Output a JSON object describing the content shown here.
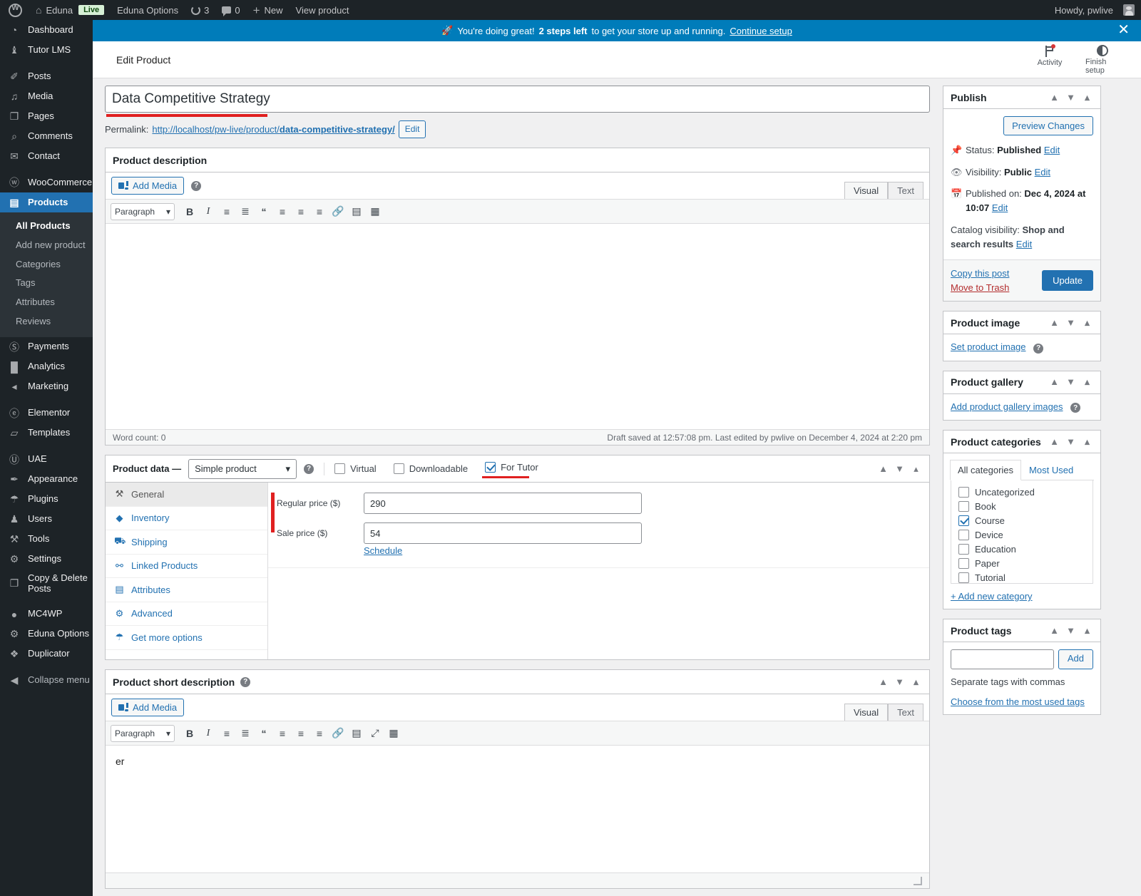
{
  "adminbar": {
    "site_name": "Eduna",
    "live_badge": "Live",
    "options_label": "Eduna Options",
    "updates_count": "3",
    "comments_count": "0",
    "new_label": "New",
    "view_product_label": "View product",
    "howdy": "Howdy, pwlive"
  },
  "notice": {
    "prefix": "You're doing great!",
    "bold": "2 steps left",
    "suffix": "to get your store up and running.",
    "link": "Continue setup",
    "close": "✕"
  },
  "wc_header": {
    "title": "Edit Product",
    "activity_label": "Activity",
    "finish_label": "Finish setup"
  },
  "sidebar": {
    "items": [
      {
        "label": "Dashboard",
        "icon": "dashboard-icon",
        "glyph": "◔"
      },
      {
        "label": "Tutor LMS",
        "icon": "tutor-lms-icon",
        "glyph": "♝"
      },
      {
        "sep": true
      },
      {
        "label": "Posts",
        "icon": "posts-icon",
        "glyph": "✐"
      },
      {
        "label": "Media",
        "icon": "media-icon",
        "glyph": "♫"
      },
      {
        "label": "Pages",
        "icon": "pages-icon",
        "glyph": "❐"
      },
      {
        "label": "Comments",
        "icon": "comments-icon",
        "glyph": "⌕"
      },
      {
        "label": "Contact",
        "icon": "contact-icon",
        "glyph": "✉"
      },
      {
        "sep": true
      },
      {
        "label": "WooCommerce",
        "icon": "woocommerce-icon",
        "glyph": "ⓦ"
      },
      {
        "label": "Products",
        "icon": "products-icon",
        "glyph": "▤",
        "current": true
      }
    ],
    "submenu": [
      {
        "label": "All Products",
        "active": true
      },
      {
        "label": "Add new product"
      },
      {
        "label": "Categories"
      },
      {
        "label": "Tags"
      },
      {
        "label": "Attributes"
      },
      {
        "label": "Reviews"
      }
    ],
    "items2": [
      {
        "label": "Payments",
        "icon": "payments-icon",
        "glyph": "Ⓢ"
      },
      {
        "label": "Analytics",
        "icon": "analytics-icon",
        "glyph": "█"
      },
      {
        "label": "Marketing",
        "icon": "marketing-icon",
        "glyph": "◂"
      },
      {
        "sep": true
      },
      {
        "label": "Elementor",
        "icon": "elementor-icon",
        "glyph": "ⓔ"
      },
      {
        "label": "Templates",
        "icon": "templates-icon",
        "glyph": "▱"
      },
      {
        "sep": true
      },
      {
        "label": "UAE",
        "icon": "uae-icon",
        "glyph": "Ⓤ"
      },
      {
        "label": "Appearance",
        "icon": "appearance-icon",
        "glyph": "✒"
      },
      {
        "label": "Plugins",
        "icon": "plugins-icon",
        "glyph": "☂"
      },
      {
        "label": "Users",
        "icon": "users-icon",
        "glyph": "♟"
      },
      {
        "label": "Tools",
        "icon": "tools-icon",
        "glyph": "⚒"
      },
      {
        "label": "Settings",
        "icon": "settings-icon",
        "glyph": "⚙"
      },
      {
        "label": "Copy & Delete Posts",
        "icon": "copy-delete-posts-icon",
        "glyph": "❐",
        "multiline": true
      },
      {
        "sep": true
      },
      {
        "label": "MC4WP",
        "icon": "mc4wp-icon",
        "glyph": "●"
      },
      {
        "label": "Eduna Options",
        "icon": "eduna-options-icon",
        "glyph": "⚙"
      },
      {
        "label": "Duplicator",
        "icon": "duplicator-icon",
        "glyph": "❖"
      },
      {
        "sep": true
      },
      {
        "label": "Collapse menu",
        "icon": "collapse-menu-icon",
        "glyph": "◀",
        "dim": true
      }
    ]
  },
  "title": {
    "value": "Data Competitive Strategy",
    "permalink_label": "Permalink:",
    "permalink_base": "http://localhost/pw-live/product/",
    "permalink_slug": "data-competitive-strategy/",
    "edit_label": "Edit"
  },
  "description_box": {
    "heading": "Product description",
    "add_media": "Add Media",
    "tab_visual": "Visual",
    "tab_text": "Text",
    "format_select": "Paragraph",
    "content": "",
    "word_count": "Word count: 0",
    "save_status": "Draft saved at 12:57:08 pm. Last edited by pwlive on December 4, 2024 at 2:20 pm"
  },
  "product_data": {
    "heading": "Product data —",
    "type_select": "Simple product",
    "virtual_label": "Virtual",
    "virtual_checked": false,
    "downloadable_label": "Downloadable",
    "downloadable_checked": false,
    "for_tutor_label": "For Tutor",
    "for_tutor_checked": true,
    "tabs": [
      {
        "label": "General",
        "glyph": "⚒",
        "active": true
      },
      {
        "label": "Inventory",
        "glyph": "◆"
      },
      {
        "label": "Shipping",
        "glyph": "⛟"
      },
      {
        "label": "Linked Products",
        "glyph": "⚯"
      },
      {
        "label": "Attributes",
        "glyph": "▤"
      },
      {
        "label": "Advanced",
        "glyph": "⚙"
      },
      {
        "label": "Get more options",
        "glyph": "☂"
      }
    ],
    "regular_price_label": "Regular price ($)",
    "regular_price_value": "290",
    "sale_price_label": "Sale price ($)",
    "sale_price_value": "54",
    "schedule_label": "Schedule"
  },
  "short_description_box": {
    "heading": "Product short description",
    "add_media": "Add Media",
    "tab_visual": "Visual",
    "tab_text": "Text",
    "format_select": "Paragraph",
    "content": "er"
  },
  "publish": {
    "heading": "Publish",
    "preview_label": "Preview Changes",
    "status_label": "Status:",
    "status_value": "Published",
    "status_edit": "Edit",
    "visibility_label": "Visibility:",
    "visibility_value": "Public",
    "visibility_edit": "Edit",
    "published_label": "Published on:",
    "published_value": "Dec 4, 2024 at 10:07",
    "published_edit": "Edit",
    "catalog_label": "Catalog visibility:",
    "catalog_value": "Shop and search results",
    "catalog_edit": "Edit",
    "copy_post": "Copy this post",
    "move_trash": "Move to Trash",
    "update_label": "Update"
  },
  "product_image": {
    "heading": "Product image",
    "link": "Set product image"
  },
  "product_gallery": {
    "heading": "Product gallery",
    "link": "Add product gallery images"
  },
  "product_categories": {
    "heading": "Product categories",
    "tab_all": "All categories",
    "tab_most_used": "Most Used",
    "items": [
      {
        "label": "Uncategorized",
        "checked": false
      },
      {
        "label": "Book",
        "checked": false
      },
      {
        "label": "Course",
        "checked": true
      },
      {
        "label": "Device",
        "checked": false
      },
      {
        "label": "Education",
        "checked": false
      },
      {
        "label": "Paper",
        "checked": false
      },
      {
        "label": "Tutorial",
        "checked": false
      }
    ],
    "add_new": "+ Add new category"
  },
  "product_tags": {
    "heading": "Product tags",
    "input_value": "",
    "add_label": "Add",
    "hint": "Separate tags with commas",
    "choose_link": "Choose from the most used tags"
  },
  "colors": {
    "accent": "#2271b1",
    "notice": "#007cba",
    "highlight": "#e02020",
    "sidebar": "#1d2327",
    "danger": "#b32d2e"
  }
}
